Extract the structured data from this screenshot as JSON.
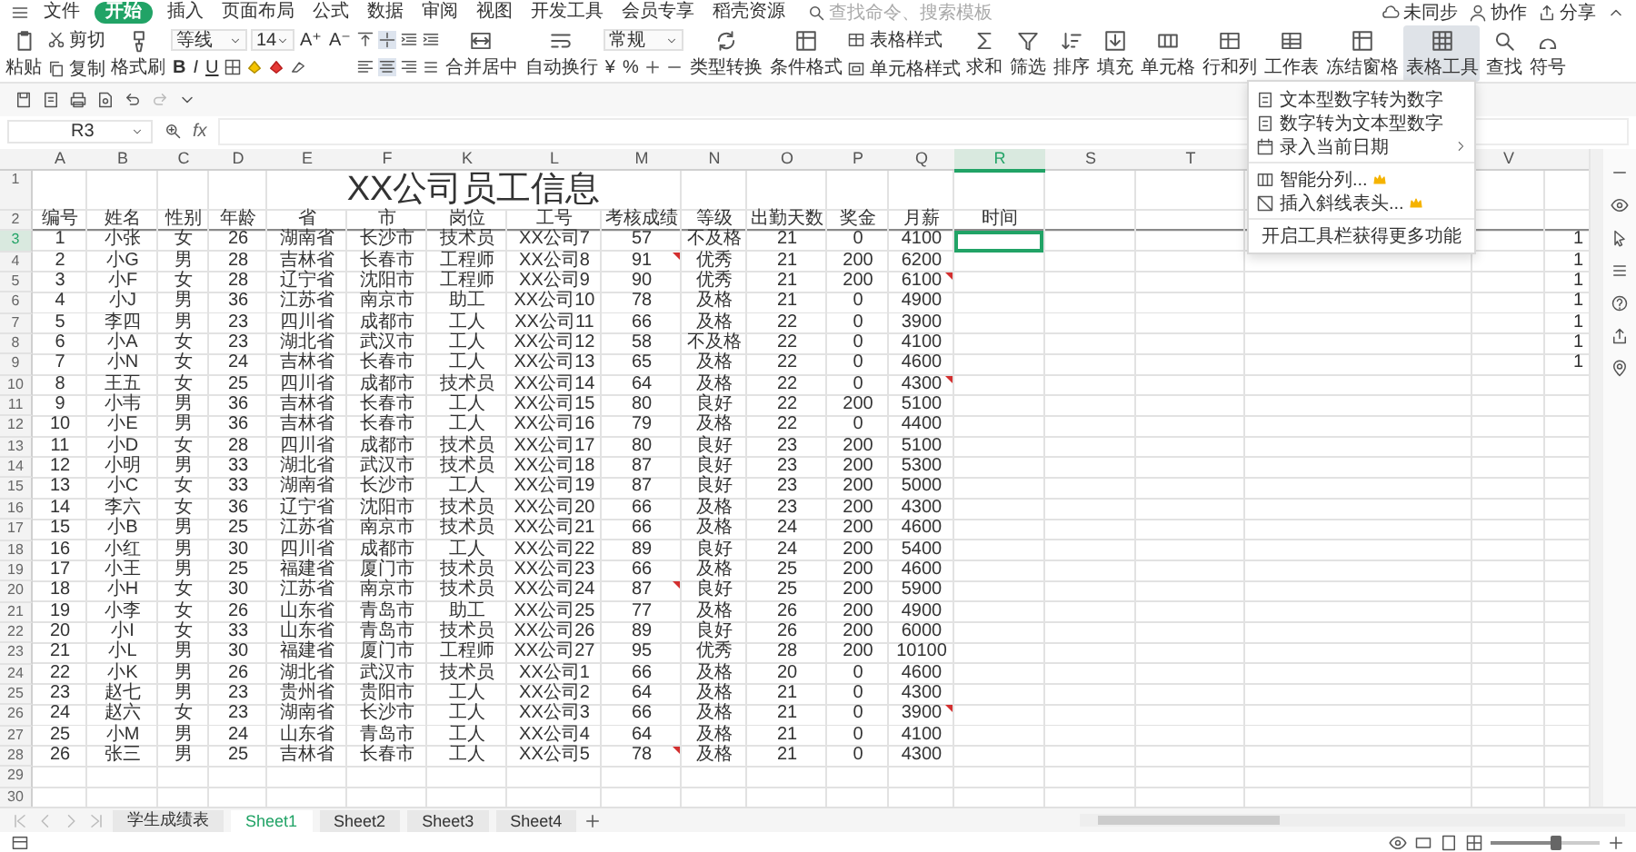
{
  "menu": {
    "items": [
      {
        "label": "文件",
        "selected": false
      },
      {
        "label": "开始",
        "selected": true
      },
      {
        "label": "插入",
        "selected": false
      },
      {
        "label": "页面布局",
        "selected": false
      },
      {
        "label": "公式",
        "selected": false
      },
      {
        "label": "数据",
        "selected": false
      },
      {
        "label": "审阅",
        "selected": false
      },
      {
        "label": "视图",
        "selected": false
      },
      {
        "label": "开发工具",
        "selected": false
      },
      {
        "label": "会员专享",
        "selected": false
      },
      {
        "label": "稻壳资源",
        "selected": false
      }
    ],
    "search": {
      "placeholder": "查找命令、搜索模板"
    },
    "right": [
      "未同步",
      "协作",
      "分享"
    ]
  },
  "ribbon": {
    "groups": [
      {
        "kind": "big",
        "label": "粘贴",
        "selected": false
      },
      {
        "kind": "pair",
        "items": [
          "剪切",
          "复制"
        ]
      },
      {
        "kind": "big",
        "label": "格式刷",
        "selected": false
      },
      {
        "kind": "font",
        "font": "等线",
        "size": "14",
        "size_buttons": [
          "A⁺",
          "A⁻"
        ],
        "style_buttons": [
          "B",
          "I",
          "U"
        ]
      },
      {
        "kind": "align"
      },
      {
        "kind": "big",
        "label": "合并居中",
        "selected": false
      },
      {
        "kind": "big",
        "label": "自动换行",
        "selected": false
      },
      {
        "kind": "number",
        "format": "常规",
        "buttons": [
          "¥",
          "%"
        ]
      },
      {
        "kind": "big",
        "label": "类型转换",
        "selected": false
      },
      {
        "kind": "big",
        "label": "条件格式",
        "selected": false
      },
      {
        "kind": "pair",
        "items": [
          "表格样式",
          "单元格样式"
        ]
      },
      {
        "kind": "big",
        "label": "求和",
        "selected": false
      },
      {
        "kind": "big",
        "label": "筛选",
        "selected": false
      },
      {
        "kind": "big",
        "label": "排序",
        "selected": false
      },
      {
        "kind": "big",
        "label": "填充",
        "selected": false
      },
      {
        "kind": "big",
        "label": "单元格",
        "selected": false
      },
      {
        "kind": "big",
        "label": "行和列",
        "selected": false
      },
      {
        "kind": "big",
        "label": "工作表",
        "selected": false
      },
      {
        "kind": "big",
        "label": "冻结窗格",
        "selected": false
      },
      {
        "kind": "big",
        "label": "表格工具",
        "selected": true
      },
      {
        "kind": "big",
        "label": "查找",
        "selected": false
      },
      {
        "kind": "big",
        "label": "符号",
        "selected": false
      }
    ]
  },
  "formula_bar": {
    "name_box": "R3",
    "fx": "fx"
  },
  "dropdown": {
    "sections": [
      [
        {
          "label": "文本型数字转为数字",
          "submenu": false,
          "vip": false
        },
        {
          "label": "数字转为文本型数字",
          "submenu": false,
          "vip": false
        },
        {
          "label": "录入当前日期",
          "submenu": true,
          "vip": false
        }
      ],
      [
        {
          "label": "智能分列...",
          "submenu": false,
          "vip": true
        },
        {
          "label": "插入斜线表头...",
          "submenu": false,
          "vip": true
        }
      ],
      [
        {
          "label": "开启工具栏获得更多功能",
          "submenu": false,
          "vip": false
        }
      ]
    ]
  },
  "columns": [
    {
      "letter": "A",
      "selected": false
    },
    {
      "letter": "B",
      "selected": false
    },
    {
      "letter": "C",
      "selected": false
    },
    {
      "letter": "D",
      "selected": false
    },
    {
      "letter": "E",
      "selected": false
    },
    {
      "letter": "F",
      "selected": false
    },
    {
      "letter": "K",
      "selected": false
    },
    {
      "letter": "L",
      "selected": false
    },
    {
      "letter": "M",
      "selected": false
    },
    {
      "letter": "N",
      "selected": false
    },
    {
      "letter": "O",
      "selected": false
    },
    {
      "letter": "P",
      "selected": false
    },
    {
      "letter": "Q",
      "selected": false
    },
    {
      "letter": "R",
      "selected": true
    },
    {
      "letter": "S",
      "selected": false
    },
    {
      "letter": "T",
      "selected": false
    }
  ],
  "columns_after_menu": [
    {
      "letter": "V",
      "selected": false
    }
  ],
  "rows": [
    {
      "label": "1",
      "selected": false
    },
    {
      "label": "2",
      "selected": false
    },
    {
      "label": "3",
      "selected": true
    },
    {
      "label": "4",
      "selected": false
    },
    {
      "label": "5",
      "selected": false
    },
    {
      "label": "6",
      "selected": false
    },
    {
      "label": "7",
      "selected": false
    },
    {
      "label": "8",
      "selected": false
    },
    {
      "label": "9",
      "selected": false
    },
    {
      "label": "10",
      "selected": false
    },
    {
      "label": "11",
      "selected": false
    },
    {
      "label": "12",
      "selected": false
    },
    {
      "label": "13",
      "selected": false
    },
    {
      "label": "14",
      "selected": false
    },
    {
      "label": "15",
      "selected": false
    },
    {
      "label": "16",
      "selected": false
    },
    {
      "label": "17",
      "selected": false
    },
    {
      "label": "18",
      "selected": false
    },
    {
      "label": "19",
      "selected": false
    },
    {
      "label": "20",
      "selected": false
    },
    {
      "label": "21",
      "selected": false
    },
    {
      "label": "22",
      "selected": false
    },
    {
      "label": "23",
      "selected": false
    },
    {
      "label": "24",
      "selected": false
    },
    {
      "label": "25",
      "selected": false
    },
    {
      "label": "26",
      "selected": false
    },
    {
      "label": "27",
      "selected": false
    },
    {
      "label": "28",
      "selected": false
    },
    {
      "label": "29",
      "selected": false
    },
    {
      "label": "30",
      "selected": false
    }
  ],
  "title": "XX公司员工信息",
  "headers": [
    "编号",
    "姓名",
    "性别",
    "年龄",
    "省",
    "市",
    "岗位",
    "工号",
    "考核成绩",
    "等级",
    "出勤天数",
    "奖金",
    "月薪",
    "时间"
  ],
  "records": [
    {
      "no": "1",
      "name": "小张",
      "gender": "女",
      "age": "26",
      "province": "湖南省",
      "city": "长沙市",
      "post": "技术员",
      "emp_id": "XX公司7",
      "score": "57",
      "grade": "不及格",
      "days": "21",
      "bonus": "0",
      "salary": "4100",
      "score_note": false,
      "salary_note": false,
      "time_selected": true,
      "column_w": "1"
    },
    {
      "no": "2",
      "name": "小G",
      "gender": "男",
      "age": "28",
      "province": "吉林省",
      "city": "长春市",
      "post": "工程师",
      "emp_id": "XX公司8",
      "score": "91",
      "grade": "优秀",
      "days": "21",
      "bonus": "200",
      "salary": "6200",
      "score_note": true,
      "salary_note": false,
      "time_selected": false,
      "column_w": "1"
    },
    {
      "no": "3",
      "name": "小F",
      "gender": "女",
      "age": "28",
      "province": "辽宁省",
      "city": "沈阳市",
      "post": "工程师",
      "emp_id": "XX公司9",
      "score": "90",
      "grade": "优秀",
      "days": "21",
      "bonus": "200",
      "salary": "6100",
      "score_note": false,
      "salary_note": true,
      "time_selected": false,
      "column_w": "1"
    },
    {
      "no": "4",
      "name": "小J",
      "gender": "男",
      "age": "36",
      "province": "江苏省",
      "city": "南京市",
      "post": "助工",
      "emp_id": "XX公司10",
      "score": "78",
      "grade": "及格",
      "days": "21",
      "bonus": "0",
      "salary": "4900",
      "score_note": false,
      "salary_note": false,
      "time_selected": false,
      "column_w": "1"
    },
    {
      "no": "5",
      "name": "李四",
      "gender": "男",
      "age": "23",
      "province": "四川省",
      "city": "成都市",
      "post": "工人",
      "emp_id": "XX公司11",
      "score": "66",
      "grade": "及格",
      "days": "22",
      "bonus": "0",
      "salary": "3900",
      "score_note": false,
      "salary_note": false,
      "time_selected": false,
      "column_w": "1"
    },
    {
      "no": "6",
      "name": "小A",
      "gender": "女",
      "age": "23",
      "province": "湖北省",
      "city": "武汉市",
      "post": "工人",
      "emp_id": "XX公司12",
      "score": "58",
      "grade": "不及格",
      "days": "22",
      "bonus": "0",
      "salary": "4100",
      "score_note": false,
      "salary_note": false,
      "time_selected": false,
      "column_w": "1"
    },
    {
      "no": "7",
      "name": "小N",
      "gender": "女",
      "age": "24",
      "province": "吉林省",
      "city": "长春市",
      "post": "工人",
      "emp_id": "XX公司13",
      "score": "65",
      "grade": "及格",
      "days": "22",
      "bonus": "0",
      "salary": "4600",
      "score_note": false,
      "salary_note": false,
      "time_selected": false,
      "column_w": "1"
    },
    {
      "no": "8",
      "name": "王五",
      "gender": "女",
      "age": "25",
      "province": "四川省",
      "city": "成都市",
      "post": "技术员",
      "emp_id": "XX公司14",
      "score": "64",
      "grade": "及格",
      "days": "22",
      "bonus": "0",
      "salary": "4300",
      "score_note": false,
      "salary_note": true,
      "time_selected": false
    },
    {
      "no": "9",
      "name": "小韦",
      "gender": "男",
      "age": "36",
      "province": "吉林省",
      "city": "长春市",
      "post": "工人",
      "emp_id": "XX公司15",
      "score": "80",
      "grade": "良好",
      "days": "22",
      "bonus": "200",
      "salary": "5100",
      "score_note": false,
      "salary_note": false,
      "time_selected": false
    },
    {
      "no": "10",
      "name": "小E",
      "gender": "男",
      "age": "36",
      "province": "吉林省",
      "city": "长春市",
      "post": "工人",
      "emp_id": "XX公司16",
      "score": "79",
      "grade": "及格",
      "days": "22",
      "bonus": "0",
      "salary": "4400",
      "score_note": false,
      "salary_note": false,
      "time_selected": false
    },
    {
      "no": "11",
      "name": "小D",
      "gender": "女",
      "age": "28",
      "province": "四川省",
      "city": "成都市",
      "post": "技术员",
      "emp_id": "XX公司17",
      "score": "80",
      "grade": "良好",
      "days": "23",
      "bonus": "200",
      "salary": "5100",
      "score_note": false,
      "salary_note": false,
      "time_selected": false
    },
    {
      "no": "12",
      "name": "小明",
      "gender": "男",
      "age": "33",
      "province": "湖北省",
      "city": "武汉市",
      "post": "技术员",
      "emp_id": "XX公司18",
      "score": "87",
      "grade": "良好",
      "days": "23",
      "bonus": "200",
      "salary": "5300",
      "score_note": false,
      "salary_note": false,
      "time_selected": false
    },
    {
      "no": "13",
      "name": "小C",
      "gender": "女",
      "age": "33",
      "province": "湖南省",
      "city": "长沙市",
      "post": "工人",
      "emp_id": "XX公司19",
      "score": "87",
      "grade": "良好",
      "days": "23",
      "bonus": "200",
      "salary": "5000",
      "score_note": false,
      "salary_note": false,
      "time_selected": false
    },
    {
      "no": "14",
      "name": "李六",
      "gender": "女",
      "age": "36",
      "province": "辽宁省",
      "city": "沈阳市",
      "post": "技术员",
      "emp_id": "XX公司20",
      "score": "66",
      "grade": "及格",
      "days": "23",
      "bonus": "200",
      "salary": "4300",
      "score_note": false,
      "salary_note": false,
      "time_selected": false
    },
    {
      "no": "15",
      "name": "小B",
      "gender": "男",
      "age": "25",
      "province": "江苏省",
      "city": "南京市",
      "post": "技术员",
      "emp_id": "XX公司21",
      "score": "66",
      "grade": "及格",
      "days": "24",
      "bonus": "200",
      "salary": "4600",
      "score_note": false,
      "salary_note": false,
      "time_selected": false
    },
    {
      "no": "16",
      "name": "小红",
      "gender": "男",
      "age": "30",
      "province": "四川省",
      "city": "成都市",
      "post": "工人",
      "emp_id": "XX公司22",
      "score": "89",
      "grade": "良好",
      "days": "24",
      "bonus": "200",
      "salary": "5400",
      "score_note": false,
      "salary_note": false,
      "time_selected": false
    },
    {
      "no": "17",
      "name": "小王",
      "gender": "男",
      "age": "25",
      "province": "福建省",
      "city": "厦门市",
      "post": "技术员",
      "emp_id": "XX公司23",
      "score": "66",
      "grade": "及格",
      "days": "25",
      "bonus": "200",
      "salary": "4600",
      "score_note": false,
      "salary_note": false,
      "time_selected": false
    },
    {
      "no": "18",
      "name": "小H",
      "gender": "女",
      "age": "30",
      "province": "江苏省",
      "city": "南京市",
      "post": "技术员",
      "emp_id": "XX公司24",
      "score": "87",
      "grade": "良好",
      "days": "25",
      "bonus": "200",
      "salary": "5900",
      "score_note": true,
      "salary_note": false,
      "time_selected": false
    },
    {
      "no": "19",
      "name": "小李",
      "gender": "女",
      "age": "26",
      "province": "山东省",
      "city": "青岛市",
      "post": "助工",
      "emp_id": "XX公司25",
      "score": "77",
      "grade": "及格",
      "days": "26",
      "bonus": "200",
      "salary": "4900",
      "score_note": false,
      "salary_note": false,
      "time_selected": false
    },
    {
      "no": "20",
      "name": "小I",
      "gender": "女",
      "age": "33",
      "province": "山东省",
      "city": "青岛市",
      "post": "技术员",
      "emp_id": "XX公司26",
      "score": "89",
      "grade": "良好",
      "days": "26",
      "bonus": "200",
      "salary": "6000",
      "score_note": false,
      "salary_note": false,
      "time_selected": false
    },
    {
      "no": "21",
      "name": "小L",
      "gender": "男",
      "age": "30",
      "province": "福建省",
      "city": "厦门市",
      "post": "工程师",
      "emp_id": "XX公司27",
      "score": "95",
      "grade": "优秀",
      "days": "28",
      "bonus": "200",
      "salary": "10100",
      "score_note": false,
      "salary_note": false,
      "time_selected": false
    },
    {
      "no": "22",
      "name": "小K",
      "gender": "男",
      "age": "26",
      "province": "湖北省",
      "city": "武汉市",
      "post": "技术员",
      "emp_id": "XX公司1",
      "score": "66",
      "grade": "及格",
      "days": "20",
      "bonus": "0",
      "salary": "4600",
      "score_note": false,
      "salary_note": false,
      "time_selected": false
    },
    {
      "no": "23",
      "name": "赵七",
      "gender": "男",
      "age": "23",
      "province": "贵州省",
      "city": "贵阳市",
      "post": "工人",
      "emp_id": "XX公司2",
      "score": "64",
      "grade": "及格",
      "days": "21",
      "bonus": "0",
      "salary": "4300",
      "score_note": false,
      "salary_note": false,
      "time_selected": false
    },
    {
      "no": "24",
      "name": "赵六",
      "gender": "女",
      "age": "23",
      "province": "湖南省",
      "city": "长沙市",
      "post": "工人",
      "emp_id": "XX公司3",
      "score": "66",
      "grade": "及格",
      "days": "21",
      "bonus": "0",
      "salary": "3900",
      "score_note": false,
      "salary_note": true,
      "time_selected": false
    },
    {
      "no": "25",
      "name": "小M",
      "gender": "男",
      "age": "24",
      "province": "山东省",
      "city": "青岛市",
      "post": "工人",
      "emp_id": "XX公司4",
      "score": "64",
      "grade": "及格",
      "days": "21",
      "bonus": "0",
      "salary": "4100",
      "score_note": false,
      "salary_note": false,
      "time_selected": false
    },
    {
      "no": "26",
      "name": "张三",
      "gender": "男",
      "age": "25",
      "province": "吉林省",
      "city": "长春市",
      "post": "工人",
      "emp_id": "XX公司5",
      "score": "78",
      "grade": "及格",
      "days": "21",
      "bonus": "0",
      "salary": "4300",
      "score_note": true,
      "salary_note": false,
      "time_selected": false
    }
  ],
  "sheet_tabs": [
    {
      "label": "学生成绩表",
      "selected": false
    },
    {
      "label": "Sheet1",
      "selected": true
    },
    {
      "label": "Sheet2",
      "selected": false
    },
    {
      "label": "Sheet3",
      "selected": false
    },
    {
      "label": "Sheet4",
      "selected": false
    }
  ],
  "status_bar": {
    "zoom": {
      "level": 0.6
    }
  }
}
